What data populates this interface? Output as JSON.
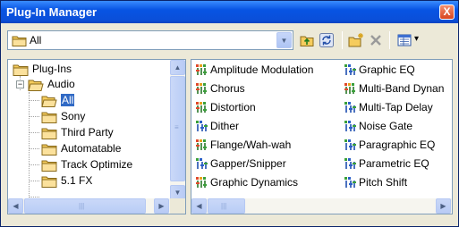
{
  "window": {
    "title": "Plug-In Manager",
    "close_glyph": "X"
  },
  "toolbar": {
    "location_value": "All",
    "dropdown_glyph": "▼",
    "view_dropdown_glyph": "▾"
  },
  "tree": {
    "items": [
      {
        "label": "Plug-Ins"
      },
      {
        "label": "Audio",
        "expander": "−"
      },
      {
        "label": "All",
        "selected": true
      },
      {
        "label": "Sony"
      },
      {
        "label": "Third Party"
      },
      {
        "label": "Automatable"
      },
      {
        "label": "Track Optimize"
      },
      {
        "label": "5.1 FX"
      }
    ]
  },
  "plugins": {
    "column1": [
      "Amplitude Modulation",
      "Chorus",
      "Distortion",
      "Dither",
      "Flange/Wah-wah",
      "Gapper/Snipper",
      "Graphic Dynamics"
    ],
    "column2": [
      "Graphic EQ",
      "Multi-Band Dynan",
      "Multi-Tap Delay",
      "Noise Gate",
      "Paragraphic EQ",
      "Parametric EQ",
      "Pitch Shift"
    ],
    "icon_styles": {
      "column1": [
        "multi",
        "multi",
        "multi",
        "single",
        "multi",
        "single",
        "multi"
      ],
      "column2": [
        "single",
        "multi",
        "single",
        "single",
        "single",
        "single",
        "single"
      ]
    }
  },
  "scroll_glyphs": {
    "up": "▲",
    "down": "▼",
    "left": "◀",
    "right": "▶",
    "grip_h": "|||",
    "grip_v": "≡"
  },
  "colors": {
    "selection": "#316ac5",
    "title_bar": "#0854e3",
    "folder": "#f5cc5d"
  }
}
